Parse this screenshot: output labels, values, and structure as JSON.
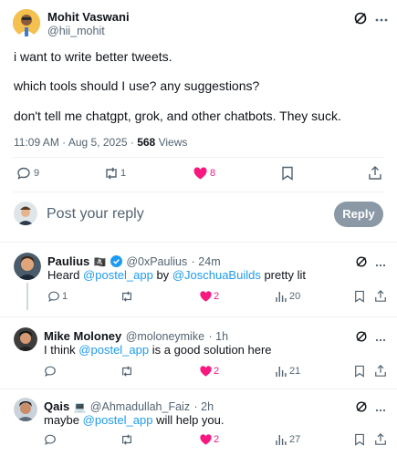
{
  "main_tweet": {
    "author_name": "Mohit Vaswani",
    "author_handle": "@hii_mohit",
    "lines": [
      "i want to write better tweets.",
      "which tools should I use? any suggestions?",
      "don't tell me chatgpt, grok, and other chatbots. They suck."
    ],
    "time": "11:09 AM · Aug 5, 2025 · ",
    "views_count": "568",
    "views_label": " Views",
    "replies": "9",
    "reposts": "1",
    "likes": "8"
  },
  "compose": {
    "placeholder": "Post your reply",
    "button": "Reply"
  },
  "replies": [
    {
      "name": "Paulius",
      "emoji": "🏴‍☠️",
      "handle": "@0xPaulius",
      "time": "· 24m",
      "text_a": "Heard ",
      "link_a": "@postel_app",
      "text_b": " by ",
      "link_b": "@JoschuaBuilds",
      "text_c": " pretty lit",
      "replies": "1",
      "likes": "2",
      "views": "20"
    },
    {
      "name": "Mike Moloney",
      "handle": "@moloneymike",
      "time": "· 1h",
      "text_a": "I think ",
      "link_a": "@postel_app",
      "text_b": " is a good solution here",
      "likes": "2",
      "views": "21"
    },
    {
      "name": "Qais",
      "emoji": "💻",
      "handle": "@Ahmadullah_Faiz",
      "time": "· 2h",
      "text_a": "maybe ",
      "link_a": "@postel_app",
      "text_b": " will help you.",
      "likes": "2",
      "views": "27"
    }
  ],
  "colors": {
    "accent": "#1d9bf0",
    "like_pink": "#f91880",
    "muted": "#536471",
    "reply_button_bg": "#8b98a5"
  }
}
